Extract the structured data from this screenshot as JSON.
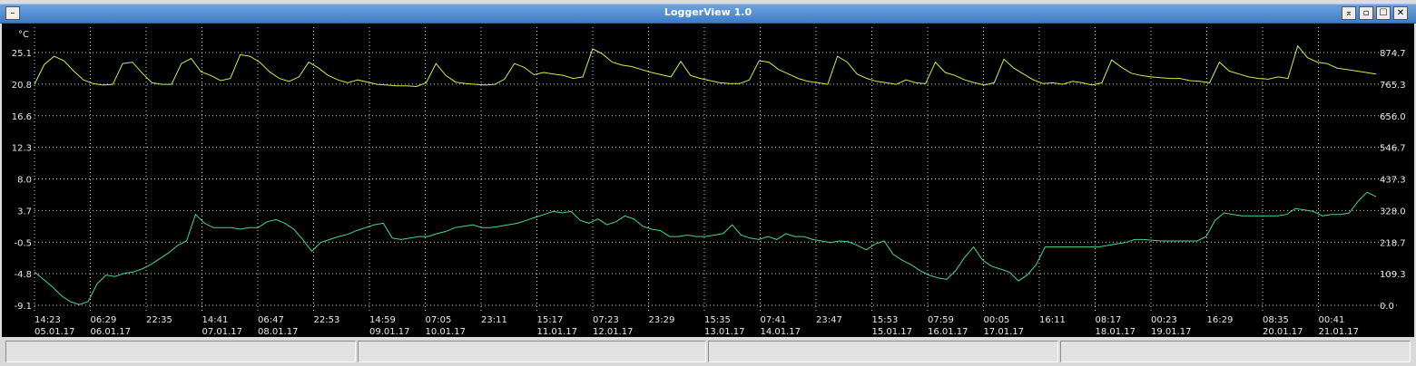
{
  "window": {
    "title": "LoggerView 1.0",
    "buttons": {
      "menu": "–",
      "b1": "⌅",
      "b2": "▫",
      "b3": "☐",
      "b4": "✕"
    }
  },
  "status_bar": {
    "panels": [
      "",
      "",
      "",
      ""
    ]
  },
  "colors": {
    "series_temp": "#c8f24a",
    "series_second": "#48d98a",
    "grid": "#d0d0d0",
    "background": "#000000"
  },
  "chart_data": {
    "type": "line",
    "left_unit": "°C",
    "left_axis_ticks": [
      "25.1",
      "20.8",
      "16.6",
      "12.3",
      "8.0",
      "3.7",
      "-0.5",
      "-4.8",
      "-9.1"
    ],
    "right_axis_ticks": [
      "874.7",
      "765.3",
      "656.0",
      "546.7",
      "437.3",
      "328.0",
      "218.7",
      "109.3",
      "0.0"
    ],
    "y_left_range": [
      -9.1,
      25.1
    ],
    "y_right_range": [
      0.0,
      874.7
    ],
    "x_tick_labels": [
      {
        "time": "14:23",
        "date": "05.01.17"
      },
      {
        "time": "06:29",
        "date": "06.01.17"
      },
      {
        "time": "22:35",
        "date": ""
      },
      {
        "time": "14:41",
        "date": "07.01.17"
      },
      {
        "time": "06:47",
        "date": "08.01.17"
      },
      {
        "time": "22:53",
        "date": ""
      },
      {
        "time": "14:59",
        "date": "09.01.17"
      },
      {
        "time": "07:05",
        "date": "10.01.17"
      },
      {
        "time": "23:11",
        "date": ""
      },
      {
        "time": "15:17",
        "date": "11.01.17"
      },
      {
        "time": "07:23",
        "date": "12.01.17"
      },
      {
        "time": "23:29",
        "date": ""
      },
      {
        "time": "15:35",
        "date": "13.01.17"
      },
      {
        "time": "07:41",
        "date": "14.01.17"
      },
      {
        "time": "23:47",
        "date": ""
      },
      {
        "time": "15:53",
        "date": "15.01.17"
      },
      {
        "time": "07:59",
        "date": "16.01.17"
      },
      {
        "time": "00:05",
        "date": "17.01.17"
      },
      {
        "time": "16:11",
        "date": ""
      },
      {
        "time": "08:17",
        "date": "18.01.17"
      },
      {
        "time": "00:23",
        "date": "19.01.17"
      },
      {
        "time": "16:29",
        "date": ""
      },
      {
        "time": "08:35",
        "date": "20.01.17"
      },
      {
        "time": "00:41",
        "date": "21.01.17"
      }
    ],
    "grid": true,
    "series": [
      {
        "axis": "left",
        "values": [
          20.8,
          23.5,
          24.6,
          24.0,
          22.6,
          21.4,
          20.9,
          20.7,
          20.8,
          23.6,
          23.8,
          22.3,
          21.0,
          20.8,
          20.8,
          23.6,
          24.3,
          22.5,
          22.0,
          21.3,
          21.6,
          24.8,
          24.6,
          23.8,
          22.5,
          21.6,
          21.2,
          21.8,
          23.8,
          23.0,
          22.0,
          21.4,
          21.0,
          21.4,
          21.1,
          20.8,
          20.7,
          20.6,
          20.6,
          20.5,
          21.0,
          23.6,
          22.0,
          21.1,
          20.9,
          20.8,
          20.7,
          20.8,
          21.5,
          23.6,
          23.1,
          22.1,
          22.4,
          22.2,
          22.0,
          21.6,
          21.8,
          25.6,
          24.9,
          23.8,
          23.4,
          23.2,
          22.8,
          22.4,
          22.1,
          21.8,
          23.9,
          22.0,
          21.6,
          21.3,
          21.0,
          20.9,
          20.9,
          21.4,
          24.0,
          23.8,
          22.8,
          22.2,
          21.6,
          21.2,
          21.0,
          20.8,
          24.6,
          23.8,
          22.2,
          21.6,
          21.2,
          21.0,
          20.8,
          21.4,
          21.0,
          20.9,
          23.8,
          22.4,
          22.0,
          21.4,
          21.0,
          20.7,
          21.0,
          24.2,
          23.0,
          22.2,
          21.4,
          20.9,
          21.0,
          20.8,
          21.2,
          21.0,
          20.7,
          21.0,
          24.1,
          23.1,
          22.3,
          22.0,
          21.8,
          21.7,
          21.6,
          21.6,
          21.3,
          21.2,
          21.0,
          23.8,
          22.6,
          22.2,
          21.8,
          21.6,
          21.5,
          21.8,
          21.6,
          26.0,
          24.4,
          23.8,
          23.6,
          23.0,
          22.8,
          22.6,
          22.4,
          22.2
        ]
      },
      {
        "axis": "left",
        "values": [
          -4.6,
          -5.6,
          -6.6,
          -7.8,
          -8.6,
          -9.0,
          -8.6,
          -6.2,
          -5.0,
          -5.2,
          -4.8,
          -4.6,
          -4.2,
          -3.6,
          -2.8,
          -2.0,
          -1.0,
          -0.4,
          3.2,
          2.0,
          1.4,
          1.4,
          1.4,
          1.2,
          1.4,
          1.4,
          2.2,
          2.5,
          2.0,
          1.2,
          -0.2,
          -1.8,
          -0.6,
          -0.2,
          0.2,
          0.5,
          1.0,
          1.4,
          1.8,
          2.0,
          0.0,
          -0.2,
          0.0,
          0.2,
          0.2,
          0.6,
          0.9,
          1.4,
          1.6,
          1.8,
          1.4,
          1.4,
          1.6,
          1.8,
          2.0,
          2.4,
          2.8,
          3.2,
          3.6,
          3.4,
          3.6,
          2.4,
          2.0,
          2.6,
          1.8,
          2.2,
          3.0,
          2.6,
          1.6,
          1.2,
          1.0,
          0.2,
          0.2,
          0.4,
          0.2,
          0.2,
          0.4,
          0.6,
          1.8,
          0.4,
          0.0,
          -0.2,
          0.2,
          -0.2,
          0.6,
          0.2,
          0.2,
          -0.2,
          -0.4,
          -0.6,
          -0.4,
          -0.5,
          -1.0,
          -1.6,
          -0.8,
          -0.4,
          -2.2,
          -3.0,
          -3.6,
          -4.4,
          -5.0,
          -5.4,
          -5.6,
          -4.4,
          -2.6,
          -1.2,
          -3.0,
          -3.8,
          -4.2,
          -4.6,
          -5.8,
          -5.0,
          -3.6,
          -1.2,
          -1.2,
          -1.2,
          -1.2,
          -1.2,
          -1.2,
          -1.2,
          -1.0,
          -0.8,
          -0.6,
          -0.2,
          -0.2,
          -0.3,
          -0.4,
          -0.4,
          -0.4,
          -0.4,
          -0.4,
          0.2,
          2.4,
          3.4,
          3.2,
          3.0,
          3.0,
          3.0,
          3.0,
          3.0,
          3.2,
          4.0,
          3.8,
          3.6,
          3.0,
          3.2,
          3.2,
          3.4,
          5.0,
          6.2,
          5.6
        ]
      }
    ]
  }
}
